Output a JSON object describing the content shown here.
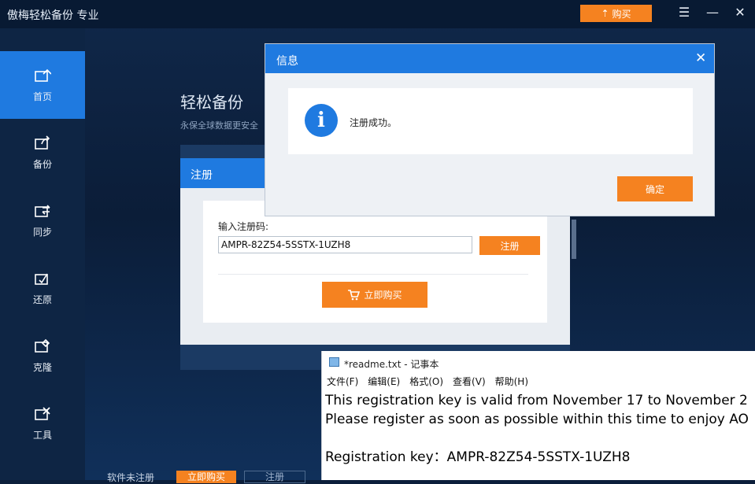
{
  "app": {
    "title": "傲梅轻松备份 专业",
    "buy_top_label": "购买",
    "menu_icon": "menu-icon",
    "minimize_label": "—",
    "close_label": "✕"
  },
  "sidebar": {
    "items": [
      {
        "label": "首页",
        "icon": "home-icon"
      },
      {
        "label": "备份",
        "icon": "backup-icon"
      },
      {
        "label": "同步",
        "icon": "sync-icon"
      },
      {
        "label": "还原",
        "icon": "restore-icon"
      },
      {
        "label": "克隆",
        "icon": "clone-icon"
      },
      {
        "label": "工具",
        "icon": "tools-icon"
      }
    ]
  },
  "main": {
    "title": "轻松备份",
    "subtitle": "永保全球数据更安全"
  },
  "status": {
    "unregistered": "软件未注册",
    "buy_now": "立即购买",
    "register": "注册"
  },
  "reg_dialog": {
    "title": "注册",
    "label": "输入注册码:",
    "key_value": "AMPR-82Z54-5SSTX-1UZH8",
    "register_button": "注册",
    "buy_button": "立即购买"
  },
  "info_dialog": {
    "title": "信息",
    "close": "✕",
    "message": "注册成功。",
    "ok_button": "确定"
  },
  "notepad": {
    "title": "*readme.txt - 记事本",
    "menu": [
      "文件(F)",
      "编辑(E)",
      "格式(O)",
      "查看(V)",
      "帮助(H)"
    ],
    "lines": [
      "This registration key is valid from November 17 to November 2",
      "Please register as soon as possible within this time to enjoy AO",
      "",
      "Registration key：AMPR-82Z54-5SSTX-1UZH8"
    ]
  },
  "colors": {
    "accent_blue": "#1f7ae0",
    "accent_orange": "#f58220",
    "background": "#0c1f3b"
  }
}
